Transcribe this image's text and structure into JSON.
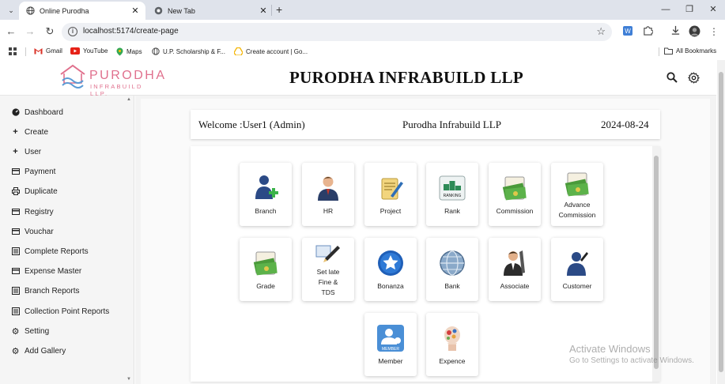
{
  "browser": {
    "tabs": [
      {
        "title": "Online Purodha",
        "active": true
      },
      {
        "title": "New Tab",
        "active": false
      }
    ],
    "url": "localhost:5174/create-page",
    "bookmarks": [
      {
        "label": "Gmail",
        "icon": "gmail-icon"
      },
      {
        "label": "YouTube",
        "icon": "youtube-icon"
      },
      {
        "label": "Maps",
        "icon": "maps-icon"
      },
      {
        "label": "U.P. Scholarship & F...",
        "icon": "globe-icon"
      },
      {
        "label": "Create account | Go...",
        "icon": "drive-icon"
      }
    ],
    "all_bookmarks": "All Bookmarks"
  },
  "header": {
    "logo_main": "PURODHA",
    "logo_sub": "INFRABUILD LLP.",
    "title": "PURODHA INFRABUILD LLP"
  },
  "sidebar": {
    "items": [
      {
        "label": "Dashboard",
        "icon": "dashboard-icon"
      },
      {
        "label": "Create",
        "icon": "plus-icon"
      },
      {
        "label": "User",
        "icon": "plus-icon"
      },
      {
        "label": "Payment",
        "icon": "card-icon"
      },
      {
        "label": "Duplicate",
        "icon": "print-icon"
      },
      {
        "label": "Registry",
        "icon": "card-icon"
      },
      {
        "label": "Vouchar",
        "icon": "card-icon"
      },
      {
        "label": "Complete Reports",
        "icon": "report-icon"
      },
      {
        "label": "Expense Master",
        "icon": "card-icon"
      },
      {
        "label": "Branch Reports",
        "icon": "report-icon"
      },
      {
        "label": "Collection Point Reports",
        "icon": "report-icon"
      },
      {
        "label": "Setting",
        "icon": "gear-icon"
      },
      {
        "label": "Add Gallery",
        "icon": "gear-icon"
      }
    ]
  },
  "welcome": {
    "greeting": "Welcome :User1 (Admin)",
    "company": "Purodha Infrabuild LLP",
    "date": "2024-08-24"
  },
  "tiles": [
    {
      "label": "Branch",
      "icon": "branch-icon"
    },
    {
      "label": "HR",
      "icon": "hr-icon"
    },
    {
      "label": "Project",
      "icon": "project-icon"
    },
    {
      "label": "Rank",
      "icon": "rank-icon",
      "icon_text": "RANKING"
    },
    {
      "label": "Commission",
      "icon": "commission-icon"
    },
    {
      "label": "Advance Commission",
      "icon": "advance-commission-icon"
    },
    {
      "label": "Grade",
      "icon": "grade-icon"
    },
    {
      "label": "Set late Fine & TDS",
      "icon": "late-fine-icon"
    },
    {
      "label": "Bonanza",
      "icon": "bonanza-icon"
    },
    {
      "label": "Bank",
      "icon": "bank-icon"
    },
    {
      "label": "Associate",
      "icon": "associate-icon"
    },
    {
      "label": "Customer",
      "icon": "customer-icon"
    },
    {
      "label": "Member",
      "icon": "member-icon",
      "icon_text": "MEMBER"
    },
    {
      "label": "Expence",
      "icon": "expence-icon"
    }
  ],
  "watermark": {
    "line1": "Activate Windows",
    "line2": "Go to Settings to activate Windows."
  }
}
